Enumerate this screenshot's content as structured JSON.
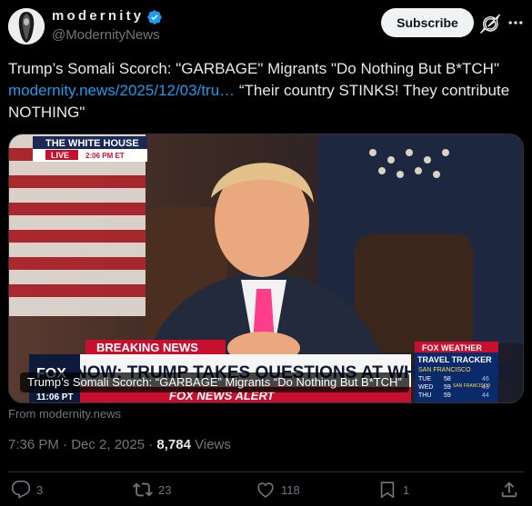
{
  "author": {
    "display_name": "modernity",
    "handle": "@ModernityNews",
    "verified_icon": "verified-badge-icon"
  },
  "header": {
    "subscribe_label": "Subscribe",
    "grok_icon": "grok-icon",
    "more_icon": "more-icon"
  },
  "tweet": {
    "text_before": "Trump’s Somali Scorch: \"GARBAGE\" Migrants \"Do Nothing But B*TCH\"",
    "link": "modernity.news/2025/12/03/tru…",
    "text_after": " “Their country STINKS! They contribute NOTHING\""
  },
  "media": {
    "caption": "Trump’s Somali Scorch: “GARBAGE” Migrants “Do Nothing But B*TCH”",
    "bug_network": "THE WHITE HOUSE",
    "bug_live": "LIVE",
    "bug_time": "2:06 PM ET",
    "banner_label": "BREAKING NEWS",
    "banner_headline": "NOW: TRUMP TAKES QUESTIONS AT WHITE HOUSE",
    "alert_label": "FOX NEWS ALERT",
    "clock": "11:06 PT",
    "logo_text": "FOX",
    "weather_title": "FOX WEATHER",
    "weather_tracker": "TRAVEL TRACKER",
    "weather_city": "SAN FRANCISCO",
    "weather_days": [
      "TUE",
      "WED",
      "THU"
    ],
    "weather_temps": [
      "58",
      "59",
      "59"
    ],
    "weather_lows": [
      "46",
      "43",
      "44"
    ],
    "weather_city2": "SAN FRANCISCO"
  },
  "card": {
    "from": "From modernity.news"
  },
  "meta": {
    "timestamp": "7:36 PM · Dec 2, 2025 · ",
    "views_count": "8,784",
    "views_label": " Views"
  },
  "actions": {
    "replies": "3",
    "reposts": "23",
    "likes": "118",
    "bookmarks": "1"
  },
  "colors": {
    "accent": "#1d9bf0",
    "background": "#000000",
    "muted": "#71767b"
  }
}
